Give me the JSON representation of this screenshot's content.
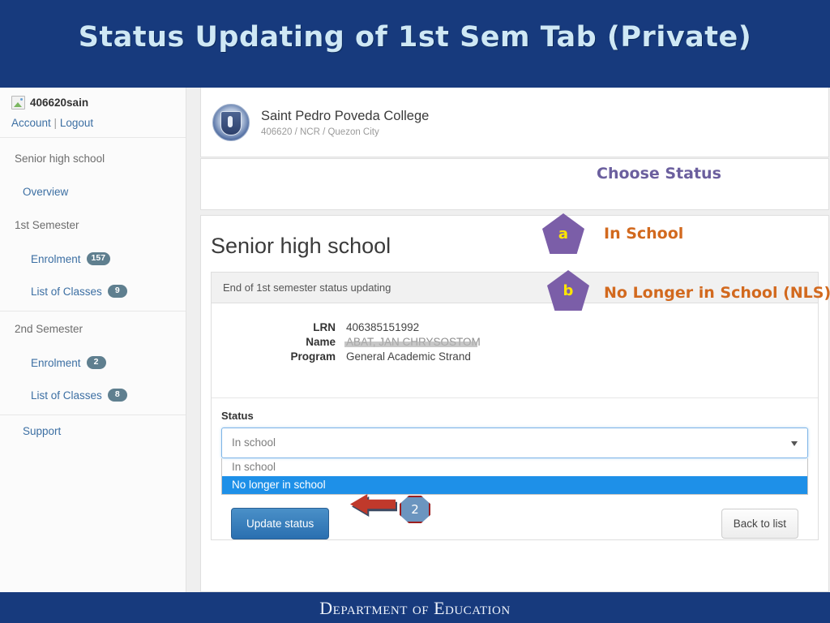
{
  "slide": {
    "title": "Status Updating of 1st Sem Tab (Private)",
    "title_bar_color": "#173a7d",
    "footer": "Department of Education"
  },
  "sidebar": {
    "user": {
      "avatar_icon": "broken-image-icon",
      "username": "406620sain",
      "account_link": "Account",
      "separator": "|",
      "logout_link": "Logout"
    },
    "sections": [
      {
        "label": "Senior high school",
        "items": [
          {
            "label": "Overview",
            "badge": ""
          }
        ]
      },
      {
        "label": "1st Semester",
        "items": [
          {
            "label": "Enrolment",
            "badge": "157"
          },
          {
            "label": "List of Classes",
            "badge": "9"
          }
        ]
      },
      {
        "label": "2nd Semester",
        "items": [
          {
            "label": "Enrolment",
            "badge": "2"
          },
          {
            "label": "List of Classes",
            "badge": "8"
          }
        ]
      }
    ],
    "support_label": "Support"
  },
  "school": {
    "logo_icon": "school-seal-icon",
    "name": "Saint Pedro Poveda College",
    "meta": "406620 / NCR / Quezon City"
  },
  "main": {
    "page_heading": "Senior high school",
    "card_title": "End of 1st semester status updating",
    "fields": [
      {
        "key": "LRN",
        "value": "406385151992",
        "redacted": false
      },
      {
        "key": "Name",
        "value": "ABAT, JAN CHRYSOSTOM",
        "redacted": true
      },
      {
        "key": "Program",
        "value": "General Academic Strand",
        "redacted": false
      }
    ],
    "status": {
      "label": "Status",
      "selected_value": "In school",
      "dropdown_open": true,
      "options": [
        {
          "label": "In school",
          "highlighted": false
        },
        {
          "label": "No longer in school",
          "highlighted": true
        }
      ],
      "caret_icon": "chevron-down-icon",
      "highlight_color": "#1e90e8"
    },
    "buttons": {
      "update": "Update status",
      "back": "Back to list"
    }
  },
  "annotations": {
    "choose_status_label": "Choose Status",
    "choose_status_color": "#6b5f9e",
    "callouts": [
      {
        "marker": "a",
        "text": "In School"
      },
      {
        "marker": "b",
        "text": "No Longer in School (NLS)"
      }
    ],
    "callout_text_color": "#d2691e",
    "marker_shape_color": "#7b5ea8",
    "marker_text_color": "#ffe600",
    "step_badge": "2",
    "arrow_icon": "left-arrow-icon",
    "arrow_color": "#c0392b"
  }
}
